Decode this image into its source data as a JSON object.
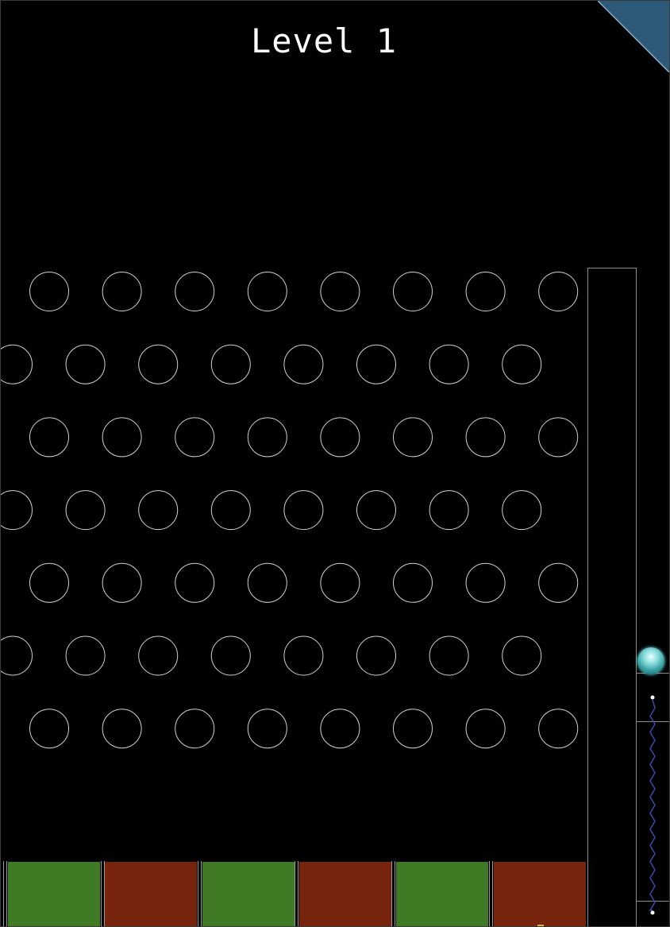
{
  "hud": {
    "level_label": "Level 1"
  },
  "board": {
    "peg_rows": [
      {
        "offset": "odd",
        "count": 8
      },
      {
        "offset": "even",
        "count": 8
      },
      {
        "offset": "odd",
        "count": 8
      },
      {
        "offset": "even",
        "count": 8
      },
      {
        "offset": "odd",
        "count": 8
      },
      {
        "offset": "even",
        "count": 8
      },
      {
        "offset": "odd",
        "count": 8
      }
    ],
    "slots": [
      {
        "result": "win",
        "color": "#3f7a25"
      },
      {
        "result": "lose",
        "color": "#76250c"
      },
      {
        "result": "win",
        "color": "#3f7a25"
      },
      {
        "result": "lose",
        "color": "#76250c"
      },
      {
        "result": "win",
        "color": "#3f7a25"
      },
      {
        "result": "lose",
        "color": "#76250c"
      }
    ]
  },
  "launcher": {
    "ball_icon": "ball-icon",
    "spring_icon": "spring-icon"
  },
  "colors": {
    "background": "#000000",
    "peg_outline": "#d0d0d0",
    "corner_flag": "#2e5a7a",
    "spring": "#3a4aa8"
  }
}
